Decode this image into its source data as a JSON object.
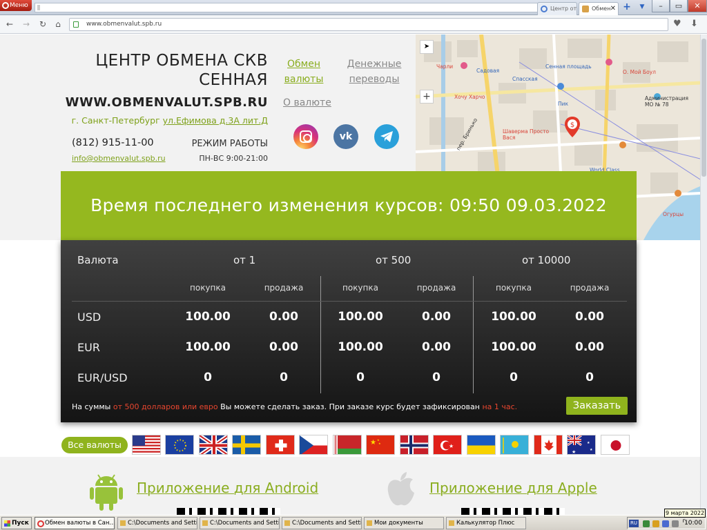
{
  "browser": {
    "menu_label": "Меню",
    "tabs": [
      {
        "label": "Центр от"
      },
      {
        "label": "Обмен"
      }
    ],
    "url": "www.obmenvalut.spb.ru"
  },
  "header": {
    "title": "ЦЕНТР ОБМЕНА СКВ СЕННАЯ",
    "site_url": "WWW.OBMENVALUT.SPB.RU",
    "address_city": "г. Санкт-Петербург",
    "address_street": "ул.Ефимова д.3А лит.Д",
    "phone": "(812) 915-11-00",
    "email": "info@obmenvalut.spb.ru",
    "hours_label": "РЕЖИМ РАБОТЫ",
    "hours_value": "ПН-ВС 9:00-21:00"
  },
  "nav": {
    "exchange": "Обмен валюты",
    "transfer": "Денежные переводы",
    "about": "О валюте"
  },
  "social": [
    "instagram-icon",
    "vk-icon",
    "telegram-icon"
  ],
  "map": {
    "labels": [
      "Чарли",
      "Садовая",
      "Сенная площадь",
      "Спасская",
      "Хочу Харчо",
      "пер. Бринько",
      "Шаверма Просто Вася",
      "Пик",
      "Администрация МО № 78",
      "О. Мой Боул",
      "World Class",
      "Огурцы"
    ]
  },
  "banner": {
    "text": "Время последнего изменения курсов: 09:50 09.03.2022"
  },
  "rates": {
    "currency_header": "Валюта",
    "tiers": [
      "от 1",
      "от 500",
      "от 10000"
    ],
    "buy_label": "покупка",
    "sell_label": "продажа",
    "rows": [
      {
        "currency": "USD",
        "values": [
          "100.00",
          "0.00",
          "100.00",
          "0.00",
          "100.00",
          "0.00"
        ]
      },
      {
        "currency": "EUR",
        "values": [
          "100.00",
          "0.00",
          "100.00",
          "0.00",
          "100.00",
          "0.00"
        ]
      },
      {
        "currency": "EUR/USD",
        "values": [
          "0",
          "0",
          "0",
          "0",
          "0",
          "0"
        ]
      }
    ],
    "note_part1": "На суммы ",
    "note_red1": "от 500 долларов или евро",
    "note_part2": " Вы можете сделать заказ. При заказе курс будет зафиксирован ",
    "note_red2": "на 1 час.",
    "order_button": "Заказать"
  },
  "currencies": {
    "all_button": "Все валюты",
    "flags": [
      "usa-flag",
      "eu-flag",
      "uk-flag",
      "sweden-flag",
      "switzerland-flag",
      "czech-flag",
      "belarus-flag",
      "china-flag",
      "norway-flag",
      "turkey-flag",
      "ukraine-flag",
      "kazakhstan-flag",
      "canada-flag",
      "australia-flag",
      "japan-flag"
    ]
  },
  "apps": {
    "android": "Приложение для Android",
    "apple": "Приложение для Apple"
  },
  "taskbar": {
    "start": "Пуск",
    "tasks": [
      "Обмен валюты в Сан...",
      "C:\\Documents and Settin...",
      "C:\\Documents and Settin...",
      "C:\\Documents and Settin...",
      "Мои документы",
      "Калькулятор Плюс"
    ],
    "lang": "RU",
    "clock": "10:00",
    "date_tooltip": "9 марта 2022 г."
  },
  "colors": {
    "accent_green": "#95b81f",
    "link_green": "#8aad1f",
    "note_red": "#e8462f",
    "panel_dark": "#1c1c1c"
  }
}
